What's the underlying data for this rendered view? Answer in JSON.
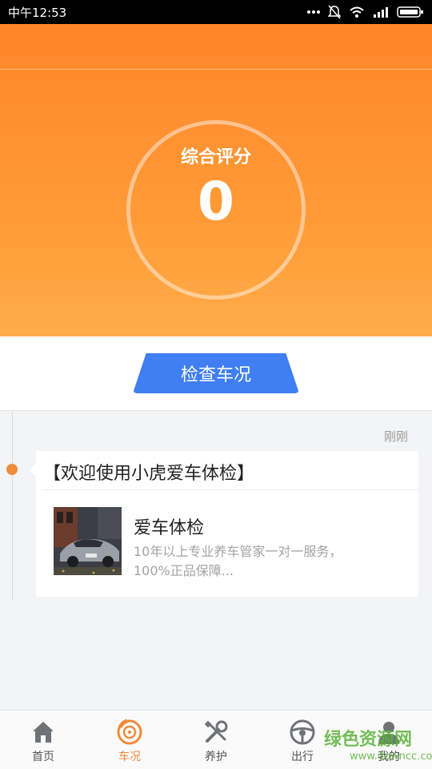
{
  "status_bar": {
    "time": "中午12:53",
    "icons": [
      "more-dots-icon",
      "mute-icon",
      "wifi-icon",
      "signal-icon",
      "battery-icon"
    ]
  },
  "hero": {
    "score_label": "综合评分",
    "score_value": "0",
    "gradient": [
      "#ff8529",
      "#ffac48"
    ]
  },
  "action": {
    "check_button": "检查车况",
    "button_color": "#3f7ef3"
  },
  "timeline": {
    "time": "刚刚",
    "dot_color": "#f08a3c",
    "card": {
      "title": "【欢迎使用小虎爱车体检】",
      "heading": "爱车体检",
      "description": "10年以上专业养车管家一对一服务，100%正品保障...",
      "image": "sports-car-photo"
    }
  },
  "tabs": [
    {
      "label": "首页",
      "icon": "home-icon",
      "active": false
    },
    {
      "label": "车况",
      "icon": "brake-disc-icon",
      "active": true
    },
    {
      "label": "养护",
      "icon": "tools-icon",
      "active": false
    },
    {
      "label": "出行",
      "icon": "steering-wheel-icon",
      "active": false
    },
    {
      "label": "我的",
      "icon": "user-icon",
      "active": false
    }
  ],
  "watermark": {
    "main": "绿色资源网",
    "sub": "www.downcc.com"
  }
}
